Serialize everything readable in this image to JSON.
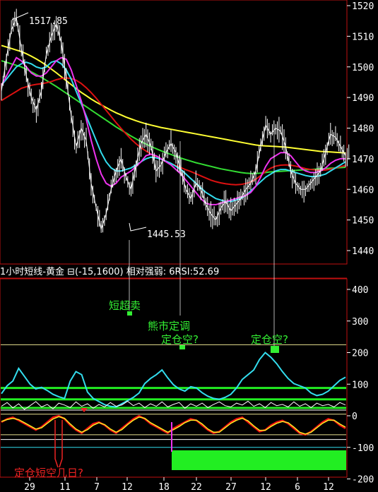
{
  "colors": {
    "background": "#000000",
    "frame": "#c01010",
    "axis_text": "#ffffff",
    "price": "#ffffff",
    "ma_yellow": "#ffff33",
    "ma_green": "#33dd33",
    "ma_red": "#dd1111",
    "ma_cyan": "#33ddee",
    "ma_magenta": "#ee33ee",
    "rsi_cyan": "#33ddee",
    "level_green": "#22ee22",
    "annotation_green": "#33ee33",
    "annotation_red": "#ee2222",
    "osc_red": "#ee1111",
    "osc_yellow": "#ffee22"
  },
  "indicator_header": "1小时短线-黄金 ⊟(-15,1600) 相对强弱: 6RSI:52.69",
  "annotations": {
    "short_oversold": "短超卖",
    "bear_correction": "熊市定调",
    "hold_short_1": "定仓空?",
    "hold_short_2": "定仓空?",
    "hold_short_days": "定仓短空几日?"
  },
  "chart_data": [
    {
      "type": "line",
      "title": "",
      "ylim": [
        1436,
        1522
      ],
      "y_ticks": [
        1520,
        1510,
        1500,
        1490,
        1480,
        1470,
        1460,
        1450,
        1440
      ],
      "high_label": "1517.85",
      "low_label": "1445.53",
      "x_tick_labels": [
        "29",
        "11",
        "7",
        "12",
        "18",
        "22",
        "27",
        "12",
        "6",
        "12"
      ],
      "series": [
        {
          "values": [
            1492,
            1503,
            1512,
            1516,
            1506,
            1497,
            1490,
            1486,
            1492,
            1504,
            1510,
            1514,
            1508,
            1496,
            1484,
            1474,
            1480,
            1476,
            1462,
            1454,
            1447,
            1452,
            1460,
            1466,
            1470,
            1464,
            1460,
            1468,
            1475,
            1478,
            1474,
            1466,
            1468,
            1472,
            1475,
            1472,
            1466,
            1460,
            1457,
            1462,
            1460,
            1455,
            1452,
            1450,
            1454,
            1456,
            1453,
            1455,
            1457,
            1460,
            1462,
            1466,
            1474,
            1481,
            1478,
            1480,
            1479,
            1474,
            1466,
            1462,
            1460,
            1460,
            1462,
            1464,
            1466,
            1472,
            1478,
            1477,
            1474,
            1471
          ]
        },
        {
          "values": [
            1507,
            1506.5,
            1506,
            1505.5,
            1505,
            1504.3,
            1503.5,
            1502.6,
            1501.6,
            1500.5,
            1499.3,
            1498.1,
            1496.8,
            1495.5,
            1494.2,
            1492.9,
            1491.7,
            1490.6,
            1489.5,
            1488.5,
            1487.6,
            1486.7,
            1485.8,
            1485,
            1484.3,
            1483.6,
            1483,
            1482.4,
            1481.9,
            1481.4,
            1481,
            1480.6,
            1480.2,
            1479.9,
            1479.6,
            1479.3,
            1479,
            1478.7,
            1478.4,
            1478.1,
            1477.8,
            1477.5,
            1477.2,
            1476.9,
            1476.6,
            1476.3,
            1476,
            1475.7,
            1475.4,
            1475.1,
            1474.8,
            1474.5,
            1474.3,
            1474.2,
            1474.1,
            1474,
            1473.9,
            1473.8,
            1473.6,
            1473.4,
            1473.2,
            1473,
            1472.8,
            1472.6,
            1472.4,
            1472.3,
            1472.2,
            1472.1,
            1472,
            1471.9
          ]
        },
        {
          "values": [
            1502,
            1501.5,
            1501,
            1500.5,
            1500,
            1499.2,
            1498.4,
            1497.5,
            1496.6,
            1495.6,
            1494.6,
            1493.6,
            1492.5,
            1491.4,
            1490.3,
            1489.2,
            1488.1,
            1487,
            1485.9,
            1484.8,
            1483.7,
            1482.6,
            1481.5,
            1480.4,
            1479.4,
            1478.4,
            1477.4,
            1476.5,
            1475.6,
            1474.8,
            1474,
            1473.3,
            1472.6,
            1472,
            1471.4,
            1470.8,
            1470.2,
            1469.7,
            1469.2,
            1468.7,
            1468.3,
            1467.9,
            1467.5,
            1467.1,
            1466.7,
            1466.4,
            1466.1,
            1465.8,
            1465.5,
            1465.3,
            1465.2,
            1465.2,
            1465.3,
            1465.5,
            1465.7,
            1465.8,
            1465.9,
            1466,
            1466.1,
            1466.2,
            1466.3,
            1466.4,
            1466.5,
            1466.6,
            1466.7,
            1466.8,
            1466.9,
            1467,
            1467.1,
            1467.2
          ]
        },
        {
          "values": [
            1489,
            1490,
            1491,
            1492,
            1493,
            1493.5,
            1494,
            1494.3,
            1494.5,
            1494.8,
            1495.2,
            1495.8,
            1496.2,
            1496.4,
            1496.2,
            1495.6,
            1494.6,
            1493.2,
            1491.6,
            1489.8,
            1487.8,
            1485.8,
            1483.8,
            1481.8,
            1479.9,
            1478.1,
            1476.4,
            1474.9,
            1473.6,
            1472.5,
            1471.5,
            1470.6,
            1469.8,
            1469.1,
            1468.4,
            1467.8,
            1467.1,
            1466.4,
            1465.8,
            1465.1,
            1464.4,
            1463.7,
            1463,
            1462.5,
            1462.1,
            1461.8,
            1461.6,
            1461.5,
            1461.6,
            1461.9,
            1462.4,
            1463.3,
            1464.5,
            1465.9,
            1466.9,
            1467.6,
            1467.9,
            1468,
            1467.9,
            1467.6,
            1467.2,
            1466.8,
            1466.5,
            1466.3,
            1466.2,
            1466.3,
            1466.6,
            1467,
            1467.4,
            1467.8
          ]
        },
        {
          "values": [
            1494,
            1496,
            1498,
            1500,
            1501,
            1501.5,
            1501,
            1500,
            1499.5,
            1500,
            1501.5,
            1502,
            1501,
            1499,
            1496,
            1492,
            1488,
            1484,
            1480,
            1476,
            1472,
            1469,
            1467,
            1466,
            1466,
            1466.5,
            1467,
            1468,
            1469,
            1470,
            1470.5,
            1470.3,
            1469.8,
            1469.2,
            1468.5,
            1467.5,
            1466.5,
            1465,
            1463.5,
            1462,
            1460.5,
            1459,
            1458,
            1457,
            1456.5,
            1456,
            1456,
            1456.5,
            1457,
            1458,
            1459.5,
            1461,
            1462.5,
            1464,
            1465,
            1466,
            1466.5,
            1466.5,
            1466,
            1465.5,
            1465,
            1464.5,
            1464.2,
            1464.2,
            1464.5,
            1465,
            1466,
            1467,
            1468,
            1469
          ]
        },
        {
          "values": [
            1494,
            1497,
            1500,
            1503,
            1502,
            1500,
            1498,
            1497,
            1497,
            1498,
            1500,
            1502,
            1503,
            1502.5,
            1499,
            1494,
            1489,
            1483,
            1476,
            1470,
            1465,
            1462,
            1461,
            1462,
            1464,
            1465,
            1466,
            1467.5,
            1469,
            1471,
            1471.5,
            1471,
            1470,
            1469,
            1468,
            1466.5,
            1465,
            1463,
            1461,
            1459,
            1457,
            1455.5,
            1455,
            1455,
            1455.5,
            1456,
            1456.5,
            1457,
            1457.5,
            1458,
            1459,
            1461,
            1464,
            1467.5,
            1470,
            1471,
            1472,
            1472,
            1471,
            1469,
            1467,
            1466,
            1465.5,
            1465.5,
            1466,
            1467,
            1468.5,
            1469.5,
            1470,
            1470
          ]
        }
      ]
    },
    {
      "type": "line",
      "ylim": [
        -200,
        440
      ],
      "y_ticks": [
        400,
        300,
        200,
        100,
        0,
        -100,
        -200
      ],
      "levels": [
        225,
        88,
        52,
        25,
        18,
        5,
        -60,
        -75,
        -100
      ],
      "series": [
        {
          "values": [
            70,
            95,
            110,
            150,
            125,
            100,
            85,
            90,
            80,
            68,
            60,
            55,
            110,
            140,
            130,
            75,
            55,
            45,
            35,
            30,
            28,
            38,
            48,
            58,
            72,
            102,
            118,
            130,
            145,
            120,
            98,
            85,
            78,
            92,
            88,
            73,
            62,
            55,
            52,
            58,
            68,
            88,
            115,
            130,
            145,
            178,
            200,
            185,
            165,
            140,
            118,
            102,
            95,
            88,
            72,
            64,
            68,
            78,
            95,
            112,
            122
          ]
        },
        {
          "values": [
            30,
            42,
            25,
            38,
            20,
            32,
            45,
            28,
            36,
            22,
            40,
            34,
            26,
            44,
            30,
            38,
            24,
            36,
            28,
            42,
            30,
            34,
            46,
            32,
            40,
            26,
            38,
            30,
            44,
            28,
            36,
            42,
            24,
            38,
            30,
            40,
            26,
            36,
            44,
            32,
            28,
            40,
            34,
            46,
            30,
            38,
            26,
            42,
            32,
            36,
            28,
            44,
            30,
            38,
            26,
            40,
            32,
            36,
            28,
            42,
            34
          ]
        },
        {
          "values": [
            -20,
            -10,
            -5,
            -15,
            -25,
            -35,
            -45,
            -35,
            -20,
            -5,
            0,
            -10,
            -30,
            -45,
            -55,
            -40,
            -25,
            -20,
            -30,
            -45,
            -55,
            -40,
            -25,
            -10,
            0,
            -10,
            -25,
            -35,
            -45,
            -55,
            -40,
            -30,
            -20,
            -10,
            -15,
            -30,
            -45,
            -55,
            -50,
            -35,
            -20,
            -10,
            -5,
            -20,
            -35,
            -50,
            -45,
            -30,
            -20,
            -15,
            -25,
            -40,
            -55,
            -60,
            -50,
            -35,
            -20,
            -10,
            -15,
            -30,
            -40
          ]
        },
        {
          "values": [
            -18,
            -12,
            -8,
            -12,
            -22,
            -32,
            -42,
            -38,
            -24,
            -10,
            -3,
            -8,
            -26,
            -42,
            -52,
            -44,
            -30,
            -22,
            -28,
            -42,
            -52,
            -44,
            -28,
            -14,
            -4,
            -8,
            -22,
            -32,
            -42,
            -52,
            -44,
            -34,
            -22,
            -14,
            -14,
            -26,
            -42,
            -52,
            -52,
            -38,
            -24,
            -14,
            -8,
            -16,
            -32,
            -46,
            -46,
            -34,
            -24,
            -18,
            -22,
            -36,
            -52,
            -58,
            -52,
            -38,
            -24,
            -14,
            -14,
            -26,
            -36
          ]
        }
      ]
    }
  ]
}
